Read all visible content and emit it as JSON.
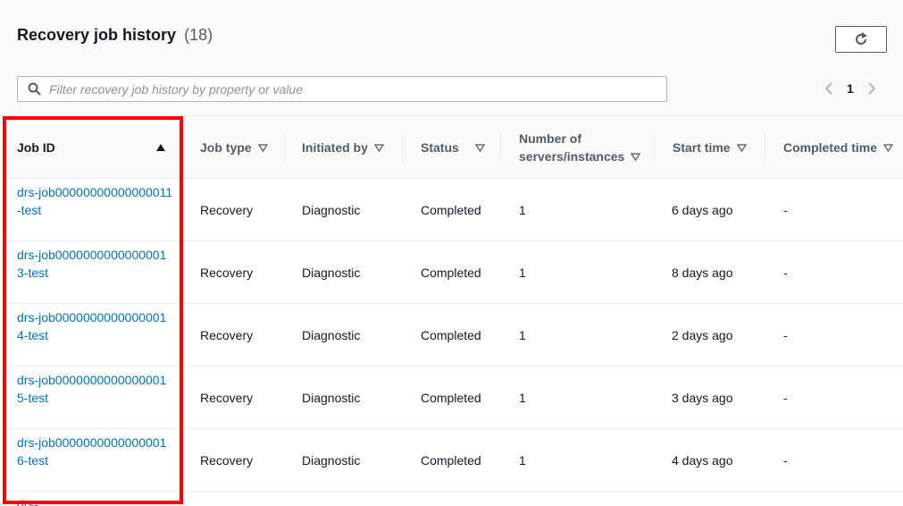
{
  "header": {
    "title": "Recovery job history",
    "count": "(18)"
  },
  "search": {
    "placeholder": "Filter recovery job history by property or value",
    "value": ""
  },
  "pagination": {
    "current_page": "1"
  },
  "table": {
    "columns": [
      {
        "label": "Job ID",
        "sort": "ascending"
      },
      {
        "label": "Job type",
        "sort": "none"
      },
      {
        "label": "Initiated by",
        "sort": "none"
      },
      {
        "label": "Status",
        "sort": "none"
      },
      {
        "label": "Number of servers/instances",
        "label_line1": "Number of",
        "label_line2": "servers/instances",
        "sort": "none"
      },
      {
        "label": "Start time",
        "sort": "none"
      },
      {
        "label": "Completed time",
        "sort": "none"
      }
    ],
    "rows": [
      {
        "job_id": "drs-job00000000000000011-test",
        "job_type": "Recovery",
        "initiated_by": "Diagnostic",
        "status": "Completed",
        "servers": "1",
        "start_time": "6 days ago",
        "completed_time": "-"
      },
      {
        "job_id": "drs-job00000000000000013-test",
        "job_type": "Recovery",
        "initiated_by": "Diagnostic",
        "status": "Completed",
        "servers": "1",
        "start_time": "8 days ago",
        "completed_time": "-"
      },
      {
        "job_id": "drs-job00000000000000014-test",
        "job_type": "Recovery",
        "initiated_by": "Diagnostic",
        "status": "Completed",
        "servers": "1",
        "start_time": "2 days ago",
        "completed_time": "-"
      },
      {
        "job_id": "drs-job00000000000000015-test",
        "job_type": "Recovery",
        "initiated_by": "Diagnostic",
        "status": "Completed",
        "servers": "1",
        "start_time": "3 days ago",
        "completed_time": "-"
      },
      {
        "job_id": "drs-job00000000000000016-test",
        "job_type": "Recovery",
        "initiated_by": "Diagnostic",
        "status": "Completed",
        "servers": "1",
        "start_time": "4 days ago",
        "completed_time": "-"
      }
    ],
    "partial_row_job_id": "drs-"
  },
  "colors": {
    "link": "#0073bb",
    "highlight": "#ff0000",
    "text": "#16191f",
    "header_text": "#545b64"
  }
}
